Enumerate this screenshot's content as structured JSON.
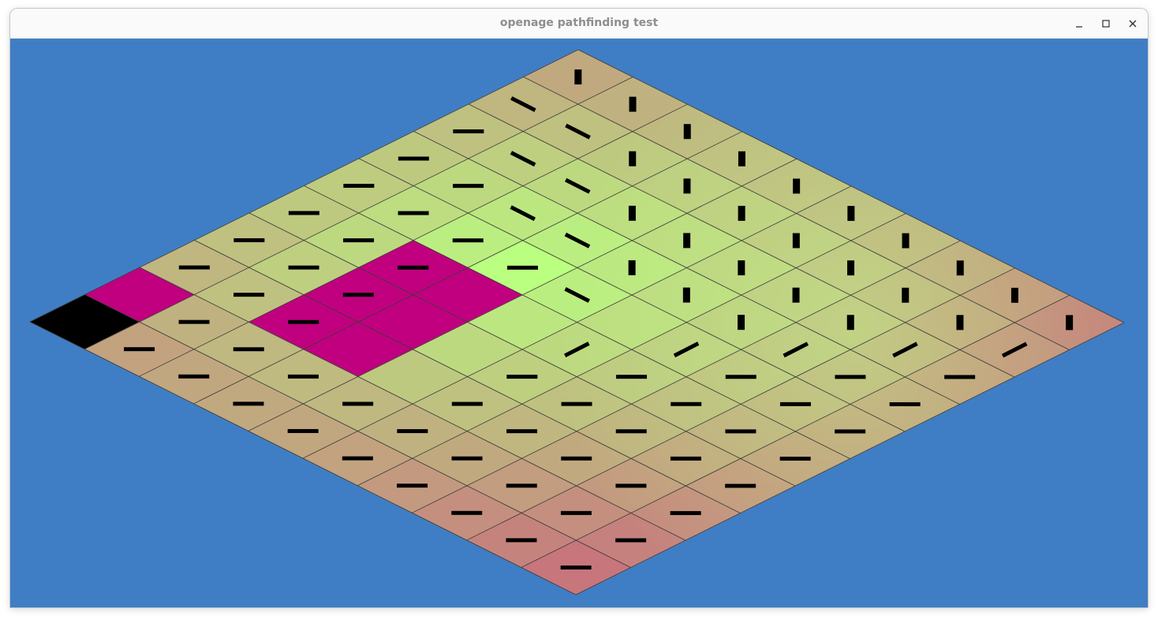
{
  "window": {
    "title": "openage pathfinding test"
  },
  "controls": {
    "minimize_icon": "minimize-icon",
    "maximize_icon": "maximize-icon",
    "close_icon": "close-icon"
  },
  "colors": {
    "background": "#3f7ec4",
    "target": "#baff80",
    "far": "#c9607b",
    "impassable": "#c0007f",
    "start": "#000000",
    "flow_arrow": "#000000",
    "grid_line": "#3b3b3b"
  },
  "grid": {
    "rows": 10,
    "cols": 10,
    "target_cell": [
      4,
      3
    ],
    "start_cell": [
      9,
      0
    ],
    "impassable_cells": [
      [
        8,
        0
      ],
      [
        5,
        2
      ],
      [
        5,
        3
      ],
      [
        6,
        2
      ],
      [
        6,
        3
      ],
      [
        7,
        2
      ],
      [
        7,
        3
      ]
    ],
    "flow_field": [
      [
        "ns",
        "ns",
        "ns",
        "ns",
        "ns",
        "ns",
        "ns",
        "ns",
        "ns",
        "ns"
      ],
      [
        "se",
        "se",
        "ns",
        "ns",
        "ns",
        "ns",
        "ns",
        "ns",
        "ns",
        "sw"
      ],
      [
        "ew",
        "se",
        "se",
        "ns",
        "ns",
        "ns",
        "ns",
        "ns",
        "sw",
        "ew"
      ],
      [
        "ew",
        "ew",
        "se",
        "se",
        "ns",
        "ns",
        "ns",
        "sw",
        "ew",
        "ew"
      ],
      [
        "ew",
        "ew",
        "ew",
        "ew",
        "se",
        null,
        "sw",
        "ew",
        "ew",
        "ew"
      ],
      [
        "ew",
        "ew",
        "ew",
        null,
        null,
        "ne",
        "ew",
        "ew",
        "ew",
        "ew"
      ],
      [
        "ew",
        "ew",
        "ew",
        null,
        null,
        "ew",
        "ew",
        "ew",
        "ew",
        "ew"
      ],
      [
        "ew",
        "ew",
        "ew",
        null,
        null,
        "ew",
        "ew",
        "ew",
        "ew",
        "ew"
      ],
      [
        null,
        "ew",
        "ew",
        "ew",
        "ew",
        "ew",
        "ew",
        "ew",
        "ew",
        "ew"
      ],
      [
        null,
        "ew",
        "ew",
        "ew",
        "ew",
        "ew",
        "ew",
        "ew",
        "ew",
        "ew"
      ]
    ]
  }
}
